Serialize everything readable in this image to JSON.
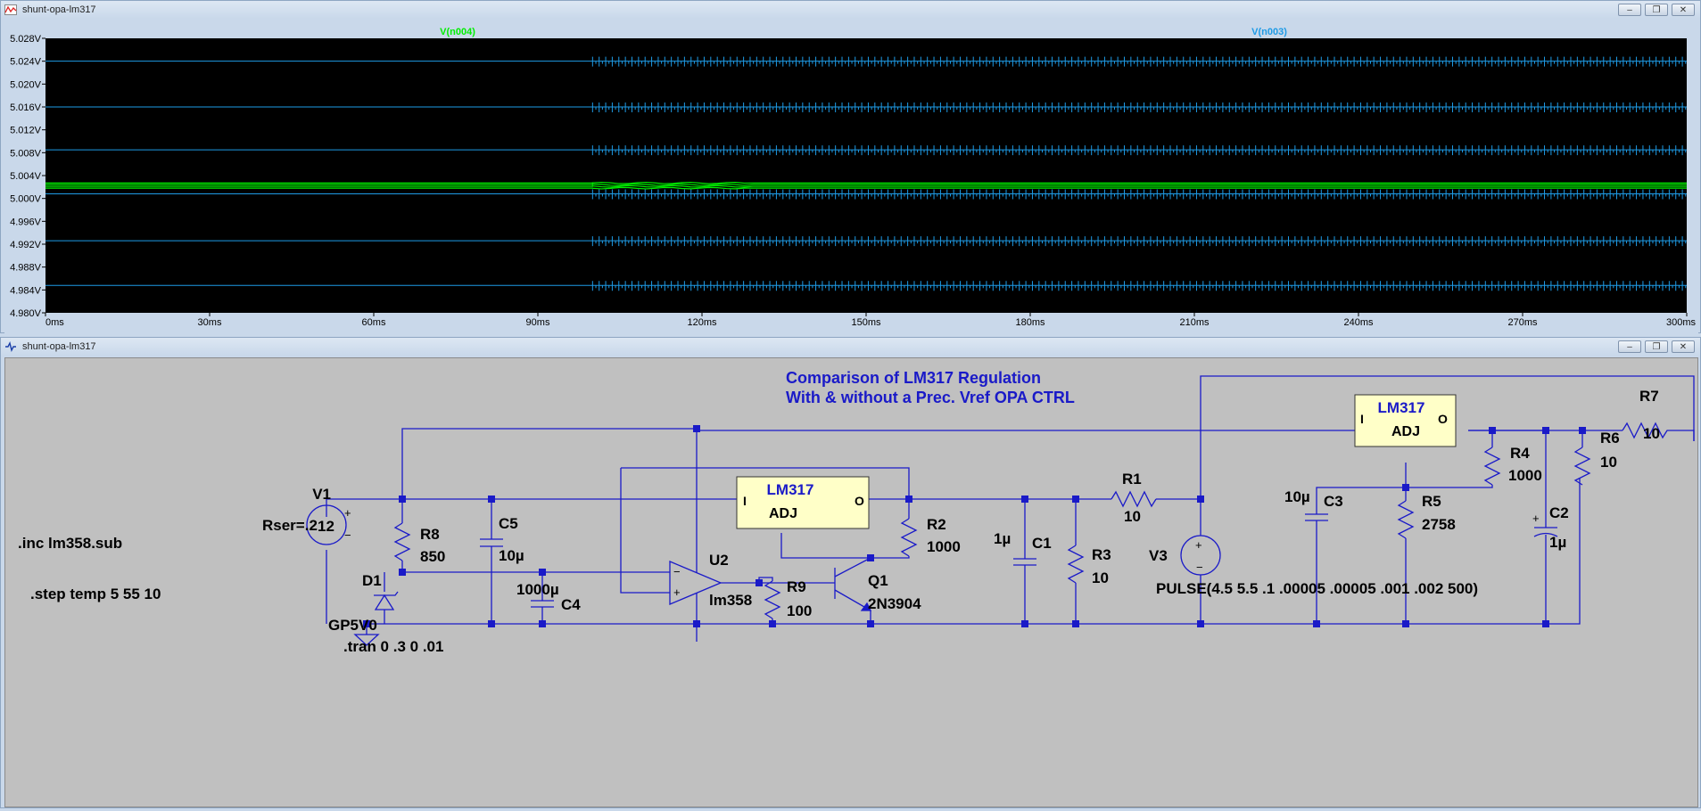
{
  "plot_window": {
    "title": "shunt-opa-lm317",
    "window_buttons": [
      "minimize-icon",
      "restore-icon",
      "close-icon"
    ]
  },
  "schematic_window": {
    "title": "shunt-opa-lm317",
    "window_buttons": [
      "minimize-icon",
      "restore-icon",
      "close-icon"
    ]
  },
  "chart_data": {
    "type": "line",
    "title": "",
    "legend": [
      "V(n004)",
      "V(n003)"
    ],
    "xlabel": "",
    "ylabel": "",
    "x_ticks": [
      "0ms",
      "30ms",
      "60ms",
      "90ms",
      "120ms",
      "150ms",
      "180ms",
      "210ms",
      "240ms",
      "270ms",
      "300ms"
    ],
    "y_ticks": [
      "5.028V",
      "5.024V",
      "5.020V",
      "5.016V",
      "5.012V",
      "5.008V",
      "5.004V",
      "5.000V",
      "4.996V",
      "4.992V",
      "4.988V",
      "4.984V",
      "4.980V"
    ],
    "xlim": [
      0,
      300
    ],
    "ylim": [
      4.98,
      5.028
    ],
    "ripple_start_ms": 100,
    "series": [
      {
        "name": "V(n004)",
        "color": "#00ee00",
        "levels": [
          5.0018,
          5.0021,
          5.0024,
          5.0027
        ]
      },
      {
        "name": "V(n003)",
        "color": "#1e9be6",
        "levels": [
          5.024,
          5.016,
          5.0085,
          5.0008,
          4.9926,
          4.9848
        ]
      }
    ]
  },
  "schematic": {
    "title_line1": "Comparison of LM317 Regulation",
    "title_line2": "With & without a Prec. Vref OPA CTRL",
    "directive_inc": ".inc lm358.sub",
    "directive_step": ".step temp 5 55 10",
    "directive_tran": ".tran 0 .3 0 .01",
    "pulse": "PULSE(4.5 5.5 .1 .00005 .00005 .001 .002 500)",
    "lm317_a": {
      "name": "LM317",
      "adj": "ADJ",
      "in": "I",
      "out": "O"
    },
    "lm317_b": {
      "name": "LM317",
      "adj": "ADJ",
      "in": "I",
      "out": "O"
    },
    "v1": {
      "name": "V1",
      "value": "12",
      "rser": "Rser=.2"
    },
    "v3": {
      "name": "V3"
    },
    "r8": {
      "name": "R8",
      "value": "850"
    },
    "c5": {
      "name": "C5",
      "value": "10µ"
    },
    "c4": {
      "name": "C4",
      "value": "1000µ"
    },
    "d1": {
      "name": "D1",
      "value": "GP5V0"
    },
    "u2": {
      "name": "U2",
      "value": "lm358"
    },
    "r9": {
      "name": "R9",
      "value": "100"
    },
    "q1": {
      "name": "Q1",
      "value": "2N3904"
    },
    "r2": {
      "name": "R2",
      "value": "1000"
    },
    "c1": {
      "name": "C1",
      "value": "1µ"
    },
    "r3": {
      "name": "R3",
      "value": "10"
    },
    "r1": {
      "name": "R1",
      "value": "10"
    },
    "c3": {
      "name": "C3",
      "value": "10µ"
    },
    "r5": {
      "name": "R5",
      "value": "2758"
    },
    "r4": {
      "name": "R4",
      "value": "1000"
    },
    "r6": {
      "name": "R6",
      "value": "10"
    },
    "c2": {
      "name": "C2",
      "value": "1µ"
    },
    "r7": {
      "name": "R7",
      "value": "10"
    },
    "opamp_minus": "−",
    "opamp_plus": "+",
    "src_plus": "+",
    "src_minus": "−",
    "cap_plus": "+"
  }
}
